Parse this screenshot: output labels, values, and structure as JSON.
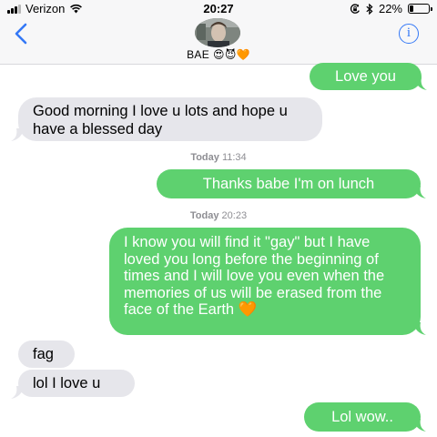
{
  "status_bar": {
    "carrier": "Verizon",
    "time": "20:27",
    "battery_percent": "22%",
    "battery_level": 0.22,
    "icons": [
      "signal-bars-icon",
      "wifi-icon",
      "lock-rotation-icon",
      "bluetooth-icon",
      "battery-icon"
    ]
  },
  "header": {
    "back_icon": "chevron-left-icon",
    "contact_name": "BAE",
    "contact_emoji": "😍😈🧡",
    "info_icon": "info-icon",
    "info_glyph": "i"
  },
  "messages": [
    {
      "direction": "sent",
      "text": "Love you"
    },
    {
      "direction": "received",
      "text": "Good morning I love u lots and hope u have a blessed day"
    },
    {
      "type": "timestamp",
      "day": "Today",
      "time": "11:34"
    },
    {
      "direction": "sent",
      "text": "Thanks babe I'm on lunch"
    },
    {
      "type": "timestamp",
      "day": "Today",
      "time": "20:23"
    },
    {
      "direction": "sent",
      "text": "I know you will find it \"gay\" but I have loved you long before the beginning of times and I will love you even when the memories of us will be erased from the face of the Earth 🧡"
    },
    {
      "direction": "received",
      "text": "fag"
    },
    {
      "direction": "received",
      "text": "lol I love u"
    },
    {
      "direction": "sent",
      "text": "Lol wow.."
    }
  ],
  "colors": {
    "sent_bubble": "#5ed16f",
    "received_bubble": "#e6e6eb",
    "accent": "#3478f6",
    "timestamp_text": "#8e8e93"
  }
}
